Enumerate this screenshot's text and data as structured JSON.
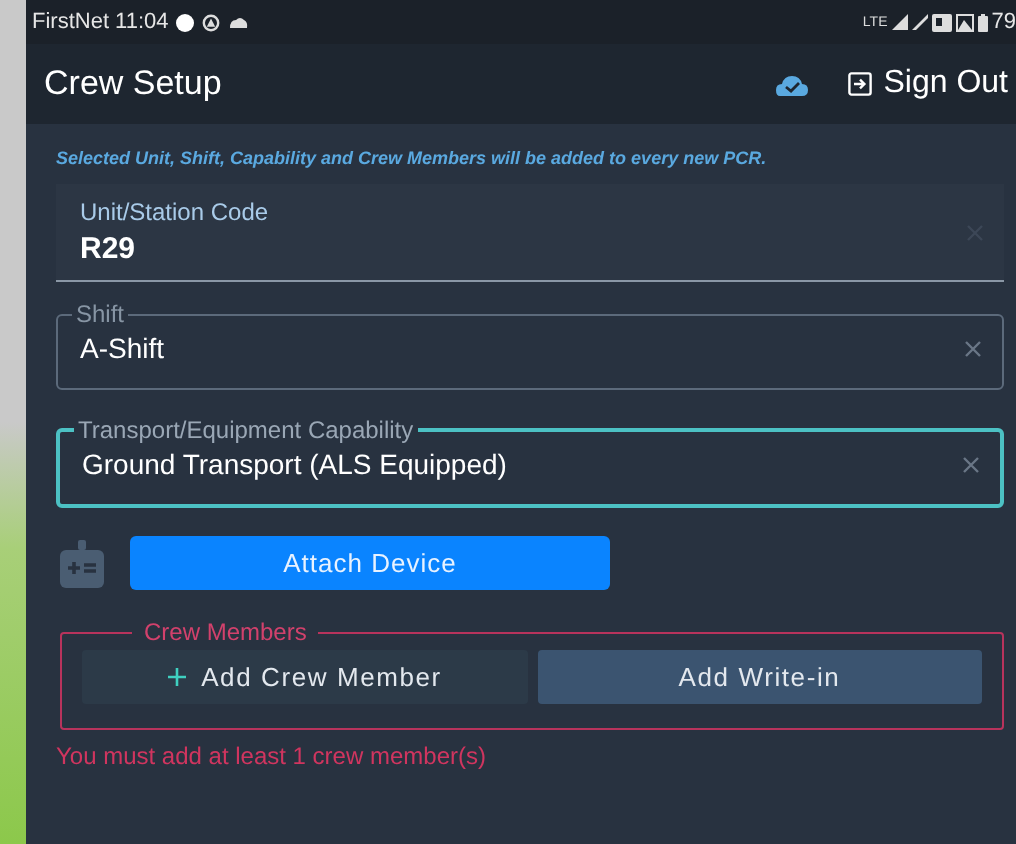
{
  "status_bar": {
    "carrier_time": "FirstNet 11:04",
    "network": "LTE",
    "battery": "79"
  },
  "header": {
    "title": "Crew Setup",
    "sign_out": "Sign Out"
  },
  "notice": "Selected Unit, Shift, Capability and Crew Members will be added to every new PCR.",
  "fields": [
    {
      "kind": "filled",
      "label": "Unit/Station Code",
      "value": "R29",
      "focused": false
    },
    {
      "kind": "outlined",
      "label": "Shift",
      "value": "A-Shift",
      "focused": false
    },
    {
      "kind": "outlined",
      "label": "Transport/Equipment Capability",
      "value": "Ground Transport (ALS Equipped)",
      "focused": true
    }
  ],
  "attach_button": "Attach Device",
  "crew_members": {
    "legend": "Crew Members",
    "buttons": [
      {
        "kind": "add",
        "label": "Add Crew Member"
      },
      {
        "kind": "plain",
        "label": "Add Write-in"
      }
    ],
    "error": "You must add at least 1 crew member(s)"
  }
}
